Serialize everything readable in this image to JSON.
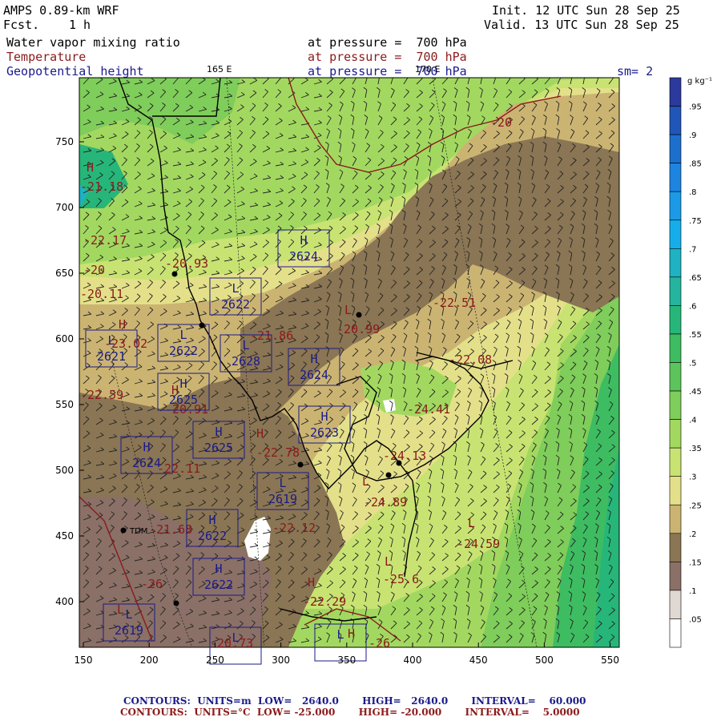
{
  "header": {
    "model": "AMPS 0.89-km WRF",
    "fcst_label": "Fcst.",
    "fcst_value": "1 h",
    "init": "Init. 12 UTC Sun 28 Sep 25",
    "valid": "Valid. 13 UTC Sun 28 Sep 25",
    "var1": "Water vapor mixing ratio",
    "var2": "Temperature",
    "var3": "Geopotential height",
    "lev1": "at pressure =  700 hPa",
    "lev2": "at pressure =  700 hPa",
    "lev3": "at pressure =  700 hPa",
    "sm": "sm= 2",
    "lon_a": "165 E",
    "lon_b": "170 E"
  },
  "axes": {
    "x_ticks": [
      "150",
      "200",
      "250",
      "300",
      "350",
      "400",
      "450",
      "500",
      "550"
    ],
    "y_ticks": [
      "750",
      "700",
      "650",
      "600",
      "550",
      "500",
      "450",
      "400"
    ]
  },
  "colorbar": {
    "unit": "g kg⁻¹",
    "labels": [
      ".95",
      ".9",
      ".85",
      ".8",
      ".75",
      ".7",
      ".65",
      ".6",
      ".55",
      ".5",
      ".45",
      ".4",
      ".35",
      ".3",
      ".25",
      ".2",
      ".15",
      ".1",
      ".05"
    ],
    "colors": [
      "#2b3a9c",
      "#1f56b8",
      "#1d6fce",
      "#1d84e0",
      "#1c9ae8",
      "#16aeea",
      "#1eb2c3",
      "#25b49e",
      "#27b679",
      "#3ebc61",
      "#5cc45a",
      "#7fcd5a",
      "#a2d860",
      "#c9e373",
      "#e4e08a",
      "#cbb472",
      "#8a7554",
      "#8a7066",
      "#e0d8d3",
      "#ffffff"
    ]
  },
  "contours": {
    "temperature_labels": [
      {
        "text": "-20",
        "pos": "ne"
      },
      {
        "text": "-21.18",
        "pos": "nw"
      },
      {
        "text": "-22.17",
        "pos": "w1"
      },
      {
        "text": "-20",
        "pos": "w2"
      },
      {
        "text": "-20.11",
        "pos": "w3"
      },
      {
        "text": "-20.93",
        "pos": "c1"
      },
      {
        "text": "-22.51",
        "pos": "e1"
      },
      {
        "text": "-20.99",
        "pos": "c2"
      },
      {
        "text": "-21.86",
        "pos": "c3"
      },
      {
        "text": "-23.02",
        "pos": "w4"
      },
      {
        "text": "-22.08",
        "pos": "e2"
      },
      {
        "text": "-22.59",
        "pos": "w5"
      },
      {
        "text": "-20.91",
        "pos": "w6"
      },
      {
        "text": "-24.41",
        "pos": "e3"
      },
      {
        "text": "-22.11",
        "pos": "w7"
      },
      {
        "text": "-22.78",
        "pos": "c4"
      },
      {
        "text": "-24.13",
        "pos": "e4"
      },
      {
        "text": "-24.89",
        "pos": "e5"
      },
      {
        "text": "-21.68",
        "pos": "w8"
      },
      {
        "text": "-22.12",
        "pos": "c5"
      },
      {
        "text": "-24.59",
        "pos": "e6"
      },
      {
        "text": "-25.6",
        "pos": "e7"
      },
      {
        "text": "-26",
        "pos": "w9"
      },
      {
        "text": "-22.29",
        "pos": "c6"
      },
      {
        "text": "-20.73",
        "pos": "s1"
      },
      {
        "text": "-26",
        "pos": "s2"
      }
    ],
    "height_labels": [
      {
        "type": "H",
        "value": "2624",
        "pos": "b1"
      },
      {
        "type": "L",
        "value": "2622",
        "pos": "b2"
      },
      {
        "type": "L",
        "value": "2622",
        "pos": "b3"
      },
      {
        "type": "L",
        "value": "2621",
        "pos": "b4"
      },
      {
        "type": "L",
        "value": "2628",
        "pos": "b5"
      },
      {
        "type": "H",
        "value": "2624",
        "pos": "b6"
      },
      {
        "type": "H",
        "value": "2625",
        "pos": "b7"
      },
      {
        "type": "H",
        "value": "2623",
        "pos": "b8"
      },
      {
        "type": "H",
        "value": "2625",
        "pos": "b9"
      },
      {
        "type": "H",
        "value": "2624",
        "pos": "b10"
      },
      {
        "type": "L",
        "value": "2619",
        "pos": "b11"
      },
      {
        "type": "H",
        "value": "2622",
        "pos": "b12"
      },
      {
        "type": "H",
        "value": "2622",
        "pos": "b13"
      },
      {
        "type": "L",
        "value": "2619",
        "pos": "b14"
      },
      {
        "type": "L",
        "value": "",
        "pos": "b15"
      },
      {
        "type": "L",
        "value": "",
        "pos": "b16"
      }
    ],
    "station": "TDM",
    "extra_marks": [
      "H",
      "L",
      "H",
      "H",
      "H",
      "L",
      "L",
      "L",
      "H",
      "L",
      "H"
    ]
  },
  "footer": {
    "line1": "CONTOURS:  UNITS=m  LOW=   2640.0       HIGH=   2640.0       INTERVAL=    60.000",
    "line2": "CONTOURS:  UNITS=°C  LOW= -25.000       HIGH= -20.000       INTERVAL=    5.0000",
    "line1_color": "#1a1a8b",
    "line2_color": "#8b1a1a"
  }
}
